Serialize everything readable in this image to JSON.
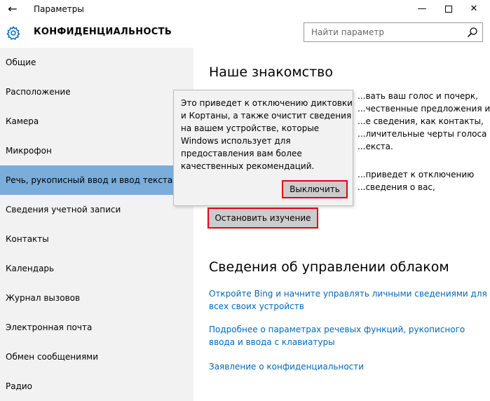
{
  "window": {
    "title": "Параметры",
    "back_icon": "←",
    "minimize_icon": "—",
    "close_icon": "✕"
  },
  "header": {
    "section_title": "КОНФИДЕНЦИАЛЬНОСТЬ",
    "search_placeholder": "Найти параметр"
  },
  "sidebar": {
    "active_index": 4,
    "items": [
      {
        "label": "Общие"
      },
      {
        "label": "Расположение"
      },
      {
        "label": "Камера"
      },
      {
        "label": "Микрофон"
      },
      {
        "label": "Речь, рукописный ввод и ввод текста"
      },
      {
        "label": "Сведения учетной записи"
      },
      {
        "label": "Контакты"
      },
      {
        "label": "Календарь"
      },
      {
        "label": "Журнал вызовов"
      },
      {
        "label": "Электронная почта"
      },
      {
        "label": "Обмен сообщениями"
      },
      {
        "label": "Радио"
      }
    ]
  },
  "main": {
    "heading": "Наше знакомство",
    "para1_lines": [
      "...вать ваш голос и почерк,",
      "...чественные предложения и",
      "...е сведения, как контакты,",
      "...личительные черты голоса и",
      "...екста."
    ],
    "para2_lines": [
      "...приведет к отключению",
      "...сведения о вас,"
    ],
    "stop_button": "Остановить изучение",
    "cloud_heading": "Сведения об управлении облаком",
    "link1_lines": [
      "Откройте Bing и начните управлять личными сведениями для",
      "всех своих устройств"
    ],
    "link2_lines": [
      "Подробнее о параметрах речевых функций, рукописного",
      "ввода и ввода с клавиатуры"
    ],
    "link3": "Заявление о конфиденциальности"
  },
  "popup": {
    "lines": [
      "Это приведет к отключению диктовки",
      "и Кортаны, а также очистит сведения",
      "на вашем устройстве, которые",
      "Windows использует для",
      "предоставления вам более",
      "качественных рекомендаций."
    ],
    "turn_off_button": "Выключить"
  }
}
